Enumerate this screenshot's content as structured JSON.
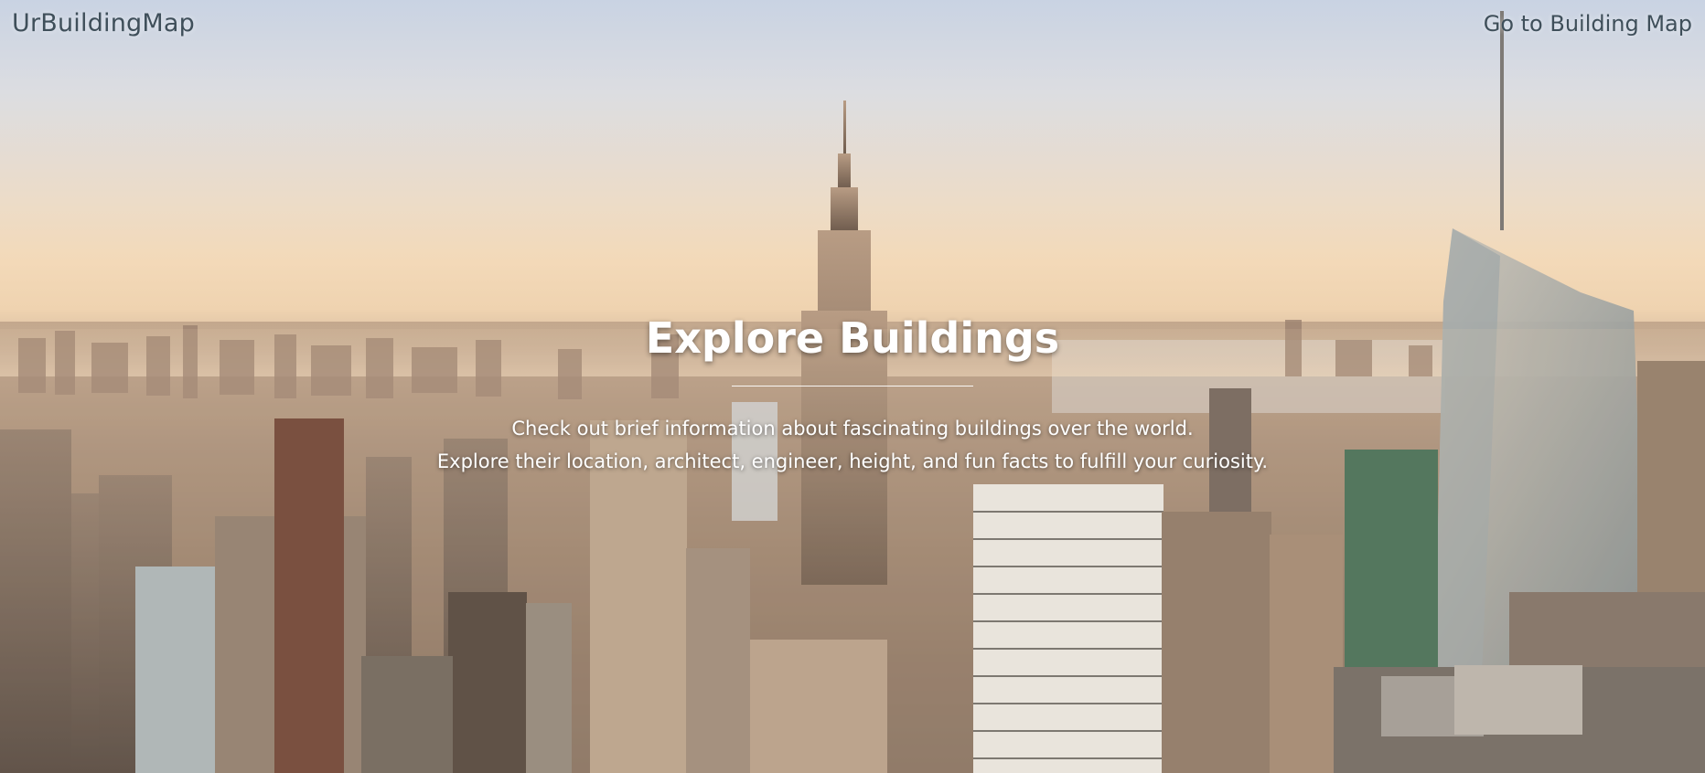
{
  "navbar": {
    "brand": "UrBuildingMap",
    "link_label": "Go to Building Map"
  },
  "hero": {
    "title": "Explore Buildings",
    "lines": [
      "Check out brief information about fascinating buildings over the world.",
      "Explore their location, architect, engineer, height, and fun facts to fulfill your curiosity."
    ]
  },
  "colors": {
    "nav_text": "#3f4f5a",
    "hero_text": "#ffffff",
    "sky_top": "#c9d3e3",
    "sky_horizon": "#f3d9b8",
    "city_dark": "#5c4e45"
  }
}
